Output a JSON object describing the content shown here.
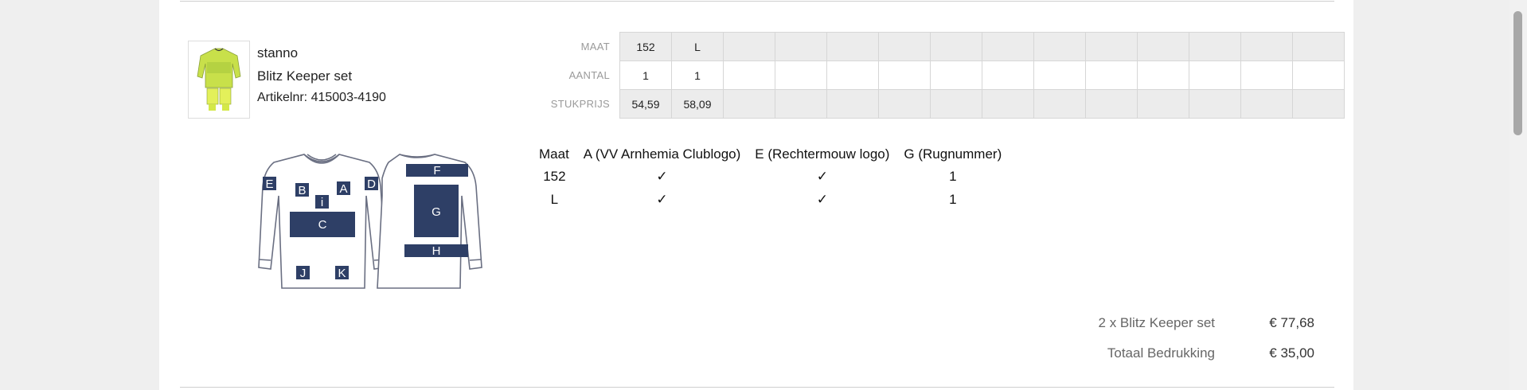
{
  "product": {
    "brand": "stanno",
    "name": "Blitz Keeper set",
    "article_label": "Artikelnr:",
    "article_number": "415003-4190"
  },
  "size_grid": {
    "rows": [
      {
        "label": "MAAT",
        "cells": [
          "152",
          "L",
          "",
          "",
          "",
          "",
          "",
          "",
          "",
          "",
          "",
          "",
          "",
          ""
        ]
      },
      {
        "label": "AANTAL",
        "cells": [
          "1",
          "1",
          "",
          "",
          "",
          "",
          "",
          "",
          "",
          "",
          "",
          "",
          "",
          ""
        ]
      },
      {
        "label": "STUKPRIJS",
        "cells": [
          "54,59",
          "58,09",
          "",
          "",
          "",
          "",
          "",
          "",
          "",
          "",
          "",
          "",
          "",
          ""
        ]
      }
    ]
  },
  "print_positions": {
    "letters": [
      "E",
      "B",
      "A",
      "D",
      "i",
      "C",
      "J",
      "K",
      "F",
      "G",
      "H"
    ]
  },
  "print_table": {
    "headers": [
      "Maat",
      "A (VV Arnhemia Clublogo)",
      "E (Rechtermouw logo)",
      "G (Rugnummer)"
    ],
    "rows": [
      [
        "152",
        "✓",
        "✓",
        "1"
      ],
      [
        "L",
        "✓",
        "✓",
        "1"
      ]
    ]
  },
  "summary": {
    "items": [
      {
        "label": "2 x Blitz Keeper set",
        "value": "€ 77,68"
      },
      {
        "label": "Totaal Bedrukking",
        "value": "€ 35,00"
      }
    ]
  },
  "colors": {
    "print_area": "#2e3f66",
    "shirt_outline": "#6a6f82",
    "jersey_yellow": "#d9ec4a"
  }
}
